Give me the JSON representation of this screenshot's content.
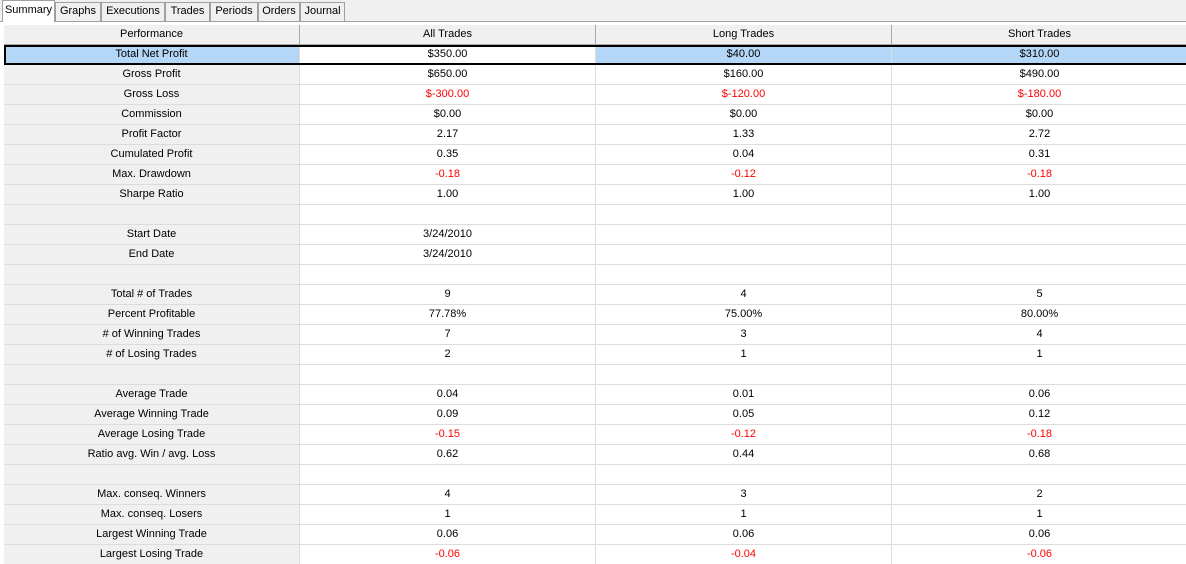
{
  "tabs": [
    "Summary",
    "Graphs",
    "Executions",
    "Trades",
    "Periods",
    "Orders",
    "Journal"
  ],
  "active_tab": "Summary",
  "columns": [
    "Performance",
    "All Trades",
    "Long Trades",
    "Short Trades"
  ],
  "rows": [
    {
      "label": "Total Net Profit",
      "values": [
        "$350.00",
        "$40.00",
        "$310.00"
      ],
      "neg": [
        false,
        false,
        false
      ],
      "selected": true
    },
    {
      "label": "Gross Profit",
      "values": [
        "$650.00",
        "$160.00",
        "$490.00"
      ],
      "neg": [
        false,
        false,
        false
      ]
    },
    {
      "label": "Gross Loss",
      "values": [
        "$-300.00",
        "$-120.00",
        "$-180.00"
      ],
      "neg": [
        true,
        true,
        true
      ]
    },
    {
      "label": "Commission",
      "values": [
        "$0.00",
        "$0.00",
        "$0.00"
      ],
      "neg": [
        false,
        false,
        false
      ]
    },
    {
      "label": "Profit Factor",
      "values": [
        "2.17",
        "1.33",
        "2.72"
      ],
      "neg": [
        false,
        false,
        false
      ]
    },
    {
      "label": "Cumulated Profit",
      "values": [
        "0.35",
        "0.04",
        "0.31"
      ],
      "neg": [
        false,
        false,
        false
      ]
    },
    {
      "label": "Max. Drawdown",
      "values": [
        "-0.18",
        "-0.12",
        "-0.18"
      ],
      "neg": [
        true,
        true,
        true
      ]
    },
    {
      "label": "Sharpe Ratio",
      "values": [
        "1.00",
        "1.00",
        "1.00"
      ],
      "neg": [
        false,
        false,
        false
      ]
    },
    {
      "label": "",
      "values": [
        "",
        "",
        ""
      ],
      "neg": [
        false,
        false,
        false
      ]
    },
    {
      "label": "Start Date",
      "values": [
        "3/24/2010",
        "",
        ""
      ],
      "neg": [
        false,
        false,
        false
      ]
    },
    {
      "label": "End Date",
      "values": [
        "3/24/2010",
        "",
        ""
      ],
      "neg": [
        false,
        false,
        false
      ]
    },
    {
      "label": "",
      "values": [
        "",
        "",
        ""
      ],
      "neg": [
        false,
        false,
        false
      ]
    },
    {
      "label": "Total # of Trades",
      "values": [
        "9",
        "4",
        "5"
      ],
      "neg": [
        false,
        false,
        false
      ]
    },
    {
      "label": "Percent Profitable",
      "values": [
        "77.78%",
        "75.00%",
        "80.00%"
      ],
      "neg": [
        false,
        false,
        false
      ]
    },
    {
      "label": "# of Winning Trades",
      "values": [
        "7",
        "3",
        "4"
      ],
      "neg": [
        false,
        false,
        false
      ]
    },
    {
      "label": "# of Losing Trades",
      "values": [
        "2",
        "1",
        "1"
      ],
      "neg": [
        false,
        false,
        false
      ]
    },
    {
      "label": "",
      "values": [
        "",
        "",
        ""
      ],
      "neg": [
        false,
        false,
        false
      ]
    },
    {
      "label": "Average Trade",
      "values": [
        "0.04",
        "0.01",
        "0.06"
      ],
      "neg": [
        false,
        false,
        false
      ]
    },
    {
      "label": "Average Winning Trade",
      "values": [
        "0.09",
        "0.05",
        "0.12"
      ],
      "neg": [
        false,
        false,
        false
      ]
    },
    {
      "label": "Average Losing Trade",
      "values": [
        "-0.15",
        "-0.12",
        "-0.18"
      ],
      "neg": [
        true,
        true,
        true
      ]
    },
    {
      "label": "Ratio avg. Win / avg. Loss",
      "values": [
        "0.62",
        "0.44",
        "0.68"
      ],
      "neg": [
        false,
        false,
        false
      ]
    },
    {
      "label": "",
      "values": [
        "",
        "",
        ""
      ],
      "neg": [
        false,
        false,
        false
      ]
    },
    {
      "label": "Max. conseq. Winners",
      "values": [
        "4",
        "3",
        "2"
      ],
      "neg": [
        false,
        false,
        false
      ]
    },
    {
      "label": "Max. conseq. Losers",
      "values": [
        "1",
        "1",
        "1"
      ],
      "neg": [
        false,
        false,
        false
      ]
    },
    {
      "label": "Largest Winning Trade",
      "values": [
        "0.06",
        "0.06",
        "0.06"
      ],
      "neg": [
        false,
        false,
        false
      ]
    },
    {
      "label": "Largest Losing Trade",
      "values": [
        "-0.06",
        "-0.04",
        "-0.06"
      ],
      "neg": [
        true,
        true,
        true
      ]
    }
  ],
  "colors": {
    "negative": "#ff0000",
    "selection": "#b5d7f7",
    "header_bg": "#f0f0f0"
  }
}
